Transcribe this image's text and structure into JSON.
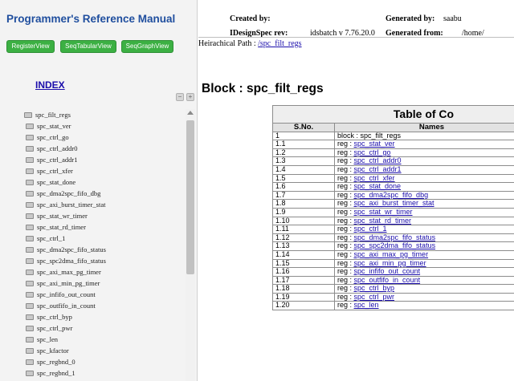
{
  "left": {
    "title": "Programmer's Reference Manual",
    "buttons": {
      "register": "RegisterView",
      "seqtabular": "SeqTabularView",
      "seqgraph": "SeqGraphView"
    },
    "index_label": "INDEX",
    "tree": {
      "root": "spc_filt_regs",
      "children": [
        "spc_stat_ver",
        "spc_ctrl_go",
        "spc_ctrl_addr0",
        "spc_ctrl_addr1",
        "spc_ctrl_xfer",
        "spc_stat_done",
        "spc_dma2spc_fifo_dbg",
        "spc_axi_burst_timer_stat",
        "spc_stat_wr_timer",
        "spc_stat_rd_timer",
        "spc_ctrl_1",
        "spc_dma2spc_fifo_status",
        "spc_spc2dma_fifo_status",
        "spc_axi_max_pg_timer",
        "spc_axi_min_pg_timer",
        "spc_infifo_out_count",
        "spc_outfifo_in_count",
        "spc_ctrl_byp",
        "spc_ctrl_pwr",
        "spc_len",
        "spc_kfactor",
        "spc_regbnd_0",
        "spc_regbnd_1"
      ]
    }
  },
  "header": {
    "created_by_label": "Created by:",
    "generated_by_label": "Generated by:",
    "generated_by_value": "saabu",
    "rev_label": "IDesignSpec rev:",
    "rev_value": "idsbatch v 7.76.20.0",
    "generated_from_label": "Generated from:",
    "generated_from_value": "/home/"
  },
  "path": {
    "label": "Heirachical Path : ",
    "link": "/spc_filt_regs"
  },
  "block_heading": "Block : spc_filt_regs",
  "toc": {
    "title": "Table of Co",
    "col_sno": "S.No.",
    "col_names": "Names",
    "rows": [
      {
        "sno": "1",
        "prefix": "block : ",
        "name": "spc_filt_regs",
        "link": false
      },
      {
        "sno": "1.1",
        "prefix": "reg : ",
        "name": "spc_stat_ver",
        "link": true
      },
      {
        "sno": "1.2",
        "prefix": "reg : ",
        "name": "spc_ctrl_go",
        "link": true
      },
      {
        "sno": "1.3",
        "prefix": "reg : ",
        "name": "spc_ctrl_addr0",
        "link": true
      },
      {
        "sno": "1.4",
        "prefix": "reg : ",
        "name": "spc_ctrl_addr1",
        "link": true
      },
      {
        "sno": "1.5",
        "prefix": "reg : ",
        "name": "spc_ctrl_xfer",
        "link": true
      },
      {
        "sno": "1.6",
        "prefix": "reg : ",
        "name": "spc_stat_done",
        "link": true
      },
      {
        "sno": "1.7",
        "prefix": "reg : ",
        "name": "spc_dma2spc_fifo_dbg",
        "link": true
      },
      {
        "sno": "1.8",
        "prefix": "reg : ",
        "name": "spc_axi_burst_timer_stat",
        "link": true
      },
      {
        "sno": "1.9",
        "prefix": "reg : ",
        "name": "spc_stat_wr_timer",
        "link": true
      },
      {
        "sno": "1.10",
        "prefix": "reg : ",
        "name": "spc_stat_rd_timer",
        "link": true
      },
      {
        "sno": "1.11",
        "prefix": "reg : ",
        "name": "spc_ctrl_1",
        "link": true
      },
      {
        "sno": "1.12",
        "prefix": "reg : ",
        "name": "spc_dma2spc_fifo_status",
        "link": true
      },
      {
        "sno": "1.13",
        "prefix": "reg : ",
        "name": "spc_spc2dma_fifo_status",
        "link": true
      },
      {
        "sno": "1.14",
        "prefix": "reg : ",
        "name": "spc_axi_max_pg_timer",
        "link": true
      },
      {
        "sno": "1.15",
        "prefix": "reg : ",
        "name": "spc_axi_min_pg_timer",
        "link": true
      },
      {
        "sno": "1.16",
        "prefix": "reg : ",
        "name": "spc_infifo_out_count",
        "link": true
      },
      {
        "sno": "1.17",
        "prefix": "reg : ",
        "name": "spc_outfifo_in_count",
        "link": true
      },
      {
        "sno": "1.18",
        "prefix": "reg : ",
        "name": "spc_ctrl_byp",
        "link": true
      },
      {
        "sno": "1.19",
        "prefix": "reg : ",
        "name": "spc_ctrl_pwr",
        "link": true
      },
      {
        "sno": "1.20",
        "prefix": "reg : ",
        "name": "spc_len",
        "link": true
      }
    ]
  },
  "colors": {
    "title_blue": "#1f4e9e",
    "button_green": "#3cb043",
    "link_blue": "#1a0dab"
  }
}
